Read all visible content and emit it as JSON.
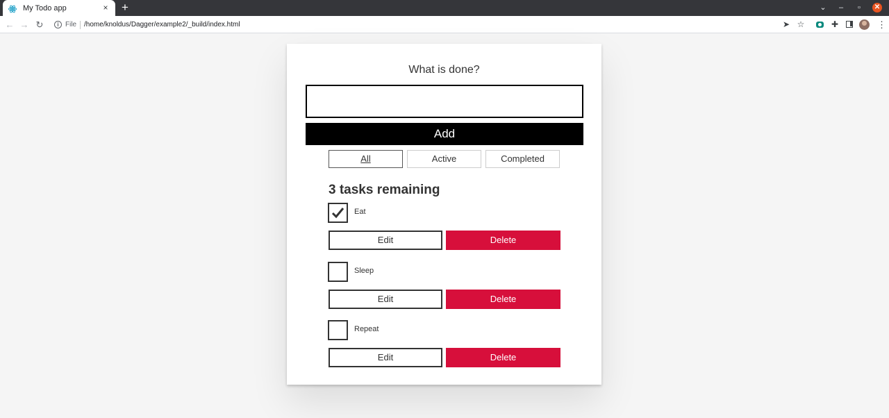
{
  "browser": {
    "tab_title": "My Todo app",
    "tab_close": "×",
    "new_tab": "+",
    "file_label": "File",
    "url": "/home/knoldus/Dagger/example2/_build/index.html",
    "window_close": "✕"
  },
  "app": {
    "label": "What is done?",
    "input_value": "",
    "add_label": "Add",
    "filters": [
      {
        "label": "All",
        "pressed": true
      },
      {
        "label": "Active",
        "pressed": false
      },
      {
        "label": "Completed",
        "pressed": false
      }
    ],
    "heading": "3 tasks remaining",
    "todos": [
      {
        "name": "Eat",
        "completed": true,
        "edit_label": "Edit",
        "delete_label": "Delete"
      },
      {
        "name": "Sleep",
        "completed": false,
        "edit_label": "Edit",
        "delete_label": "Delete"
      },
      {
        "name": "Repeat",
        "completed": false,
        "edit_label": "Edit",
        "delete_label": "Delete"
      }
    ],
    "colors": {
      "delete": "#d70f3b",
      "add": "#000000"
    }
  },
  "icons": [
    "react-favicon-icon",
    "back-arrow-icon",
    "forward-arrow-icon",
    "reload-icon",
    "info-icon",
    "share-icon",
    "star-icon",
    "extension-icon",
    "puzzle-icon",
    "side-panel-icon",
    "avatar",
    "kebab-menu-icon",
    "checkmark-icon"
  ]
}
